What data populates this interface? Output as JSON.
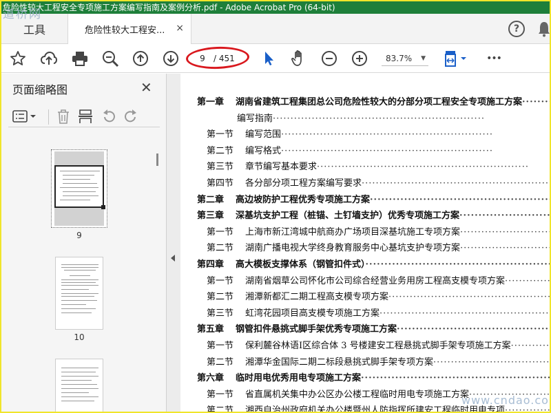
{
  "window": {
    "title": "危险性较大工程安全专项施工方案编写指南及案例分析.pdf - Adobe Acrobat Pro (64-bit)",
    "watermark_top": "道桥网",
    "watermark_bottom": "www.cndao.com"
  },
  "tabs": {
    "tools_label": "工具",
    "doc_label": "危险性较大工程安...",
    "close_label": "×"
  },
  "header_icons": {
    "help": "?"
  },
  "toolbar": {
    "page_current": "9",
    "page_total": "/ 451",
    "zoom": "83.7%",
    "more": "•••"
  },
  "sidebar": {
    "title": "页面缩略图",
    "close_label": "✕",
    "thumbnails": [
      {
        "label": "9",
        "active": true
      },
      {
        "label": "10",
        "active": false
      },
      {
        "label": "",
        "active": false
      }
    ]
  },
  "toc": [
    {
      "type": "chapter",
      "num": "第一章",
      "text": "湖南省建筑工程集团总公司危险性较大的分部分项工程安全专项施工方案"
    },
    {
      "type": "cont",
      "num": "",
      "text": "编写指南"
    },
    {
      "type": "section",
      "num": "第一节",
      "text": "编写范围"
    },
    {
      "type": "section",
      "num": "第二节",
      "text": "编写格式"
    },
    {
      "type": "section",
      "num": "第三节",
      "text": "章节编写基本要求"
    },
    {
      "type": "section",
      "num": "第四节",
      "text": "各分部分项工程方案编写要求"
    },
    {
      "type": "chapter",
      "num": "第二章",
      "text": "高边坡防护工程优秀专项施工方案"
    },
    {
      "type": "chapter",
      "num": "第三章",
      "text": "深基坑支护工程（桩锚、土钉墙支护）优秀专项施工方案"
    },
    {
      "type": "section",
      "num": "第一节",
      "text": "上海市新江湾城中航商办广场项目深基坑施工专项方案"
    },
    {
      "type": "section",
      "num": "第二节",
      "text": "湖南广播电视大学终身教育服务中心基坑支护专项方案"
    },
    {
      "type": "chapter",
      "num": "第四章",
      "text": "高大模板支撑体系（钢管扣件式）"
    },
    {
      "type": "section",
      "num": "第一节",
      "text": "湖南省烟草公司怀化市公司综合经营业务用房工程高支模专项方案"
    },
    {
      "type": "section",
      "num": "第二节",
      "text": "湘潭新都汇二期工程高支模专项方案"
    },
    {
      "type": "section",
      "num": "第三节",
      "text": "虹湾花园项目高支模专项施工方案"
    },
    {
      "type": "chapter",
      "num": "第五章",
      "text": "钢管扣件悬挑式脚手架优秀专项施工方案"
    },
    {
      "type": "section",
      "num": "第一节",
      "text": "保利麓谷林语Ⅰ区综合体 3 号楼建安工程悬挑式脚手架专项施工方案"
    },
    {
      "type": "section",
      "num": "第二节",
      "text": "湘潭华金国际二期二标段悬挑式脚手架专项方案"
    },
    {
      "type": "chapter",
      "num": "第六章",
      "text": "临时用电优秀用电专项施工方案"
    },
    {
      "type": "section",
      "num": "第一节",
      "text": "省直属机关集中办公区办公楼工程临时用电专项施工方案"
    },
    {
      "type": "section",
      "num": "第二节",
      "text": "湘西自治州政府机关办公楼暨州人防指挥所建安工程临时用电专项"
    }
  ]
}
